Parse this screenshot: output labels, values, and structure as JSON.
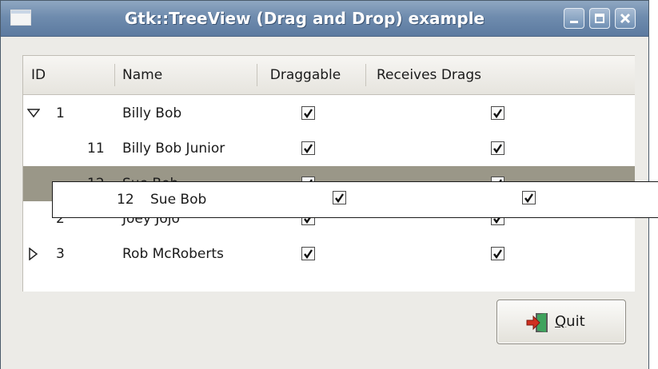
{
  "window": {
    "title": "Gtk::TreeView (Drag and Drop) example",
    "buttons": [
      "minimize",
      "maximize",
      "close"
    ]
  },
  "tree": {
    "columns": [
      "ID",
      "Name",
      "Draggable",
      "Receives Drags"
    ],
    "rows": [
      {
        "id": "1",
        "name": "Billy Bob",
        "draggable": true,
        "receives": true,
        "expander": "expanded",
        "depth": 0,
        "selected": false
      },
      {
        "id": "11",
        "name": "Billy Bob Junior",
        "draggable": true,
        "receives": true,
        "expander": "none",
        "depth": 1,
        "selected": false
      },
      {
        "id": "12",
        "name": "Sue Bob",
        "draggable": true,
        "receives": true,
        "expander": "none",
        "depth": 1,
        "selected": true
      },
      {
        "id": "2",
        "name": "Joey Jojo",
        "draggable": true,
        "receives": true,
        "expander": "none",
        "depth": 0,
        "selected": false
      },
      {
        "id": "3",
        "name": "Rob McRoberts",
        "draggable": true,
        "receives": true,
        "expander": "collapsed",
        "depth": 0,
        "selected": false
      }
    ]
  },
  "drag_row": {
    "id": "12",
    "name": "Sue Bob",
    "draggable": true,
    "receives": true
  },
  "quit_button": {
    "mnemonic": "Q",
    "rest": "uit",
    "icon": "exit-icon"
  },
  "colors": {
    "titlebar": "#6f8cae",
    "selection": "#9a9788",
    "background": "#ecebe7"
  }
}
